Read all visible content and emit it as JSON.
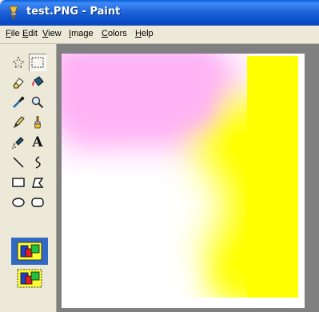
{
  "window": {
    "title": "test.PNG - Paint",
    "app_icon": "paint-brush-icon"
  },
  "menu": {
    "items": [
      "File",
      "Edit",
      "View",
      "Image",
      "Colors",
      "Help"
    ]
  },
  "tools": [
    {
      "name": "free-form-select-icon",
      "selected": false
    },
    {
      "name": "rectangle-select-icon",
      "selected": true
    },
    {
      "name": "eraser-icon",
      "selected": false
    },
    {
      "name": "fill-bucket-icon",
      "selected": false
    },
    {
      "name": "color-picker-icon",
      "selected": false
    },
    {
      "name": "magnifier-icon",
      "selected": false
    },
    {
      "name": "pencil-icon",
      "selected": false
    },
    {
      "name": "brush-icon",
      "selected": false
    },
    {
      "name": "airbrush-icon",
      "selected": false
    },
    {
      "name": "text-icon",
      "selected": false
    },
    {
      "name": "line-icon",
      "selected": false
    },
    {
      "name": "curve-icon",
      "selected": false
    },
    {
      "name": "rectangle-icon",
      "selected": false
    },
    {
      "name": "polygon-icon",
      "selected": false
    },
    {
      "name": "ellipse-icon",
      "selected": false
    },
    {
      "name": "rounded-rectangle-icon",
      "selected": false
    }
  ],
  "tool_glyphs": {
    "text": "A"
  },
  "options": [
    {
      "name": "opaque-selection-icon",
      "selected": true
    },
    {
      "name": "transparent-selection-icon",
      "selected": false
    }
  ],
  "canvas": {
    "colors": {
      "pink": "#ffb3f6",
      "yellow": "#ffff00",
      "white": "#ffffff"
    }
  }
}
